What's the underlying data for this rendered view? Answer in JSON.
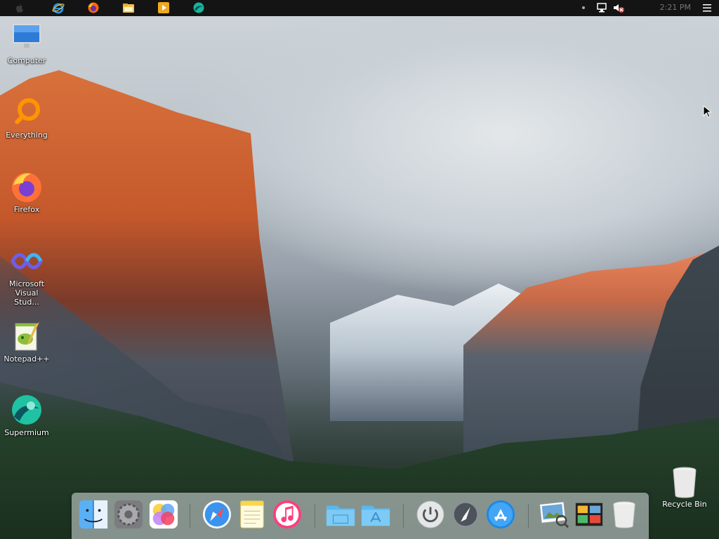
{
  "topbar": {
    "icons": [
      "apple-icon",
      "internet-explorer-icon",
      "firefox-icon",
      "file-explorer-icon",
      "media-player-icon",
      "supermium-icon"
    ],
    "tray": [
      "tray-dot-icon",
      "network-icon",
      "volume-muted-icon",
      "menu-icon"
    ],
    "clock": "2:21 PM"
  },
  "desktop_icons": [
    {
      "label": "Computer"
    },
    {
      "label": "Everything"
    },
    {
      "label": "Firefox"
    },
    {
      "label": "Microsoft Visual Stud..."
    },
    {
      "label": "Notepad++"
    },
    {
      "label": "Supermium"
    }
  ],
  "recycle_bin": {
    "label": "Recycle Bin"
  },
  "dock": {
    "items": [
      "finder-icon",
      "system-preferences-icon",
      "game-center-icon",
      "safari-icon",
      "notes-icon",
      "itunes-icon",
      "folder-icon",
      "applications-folder-icon",
      "power-icon",
      "launchpad-icon",
      "app-store-icon",
      "preview-icon",
      "photo-gallery-icon",
      "trash-icon"
    ]
  },
  "colors": {
    "topbar": "#141414",
    "dock": "rgba(220,225,230,.55)",
    "accent_orange": "#ff9400",
    "accent_blue": "#1e88e5"
  }
}
